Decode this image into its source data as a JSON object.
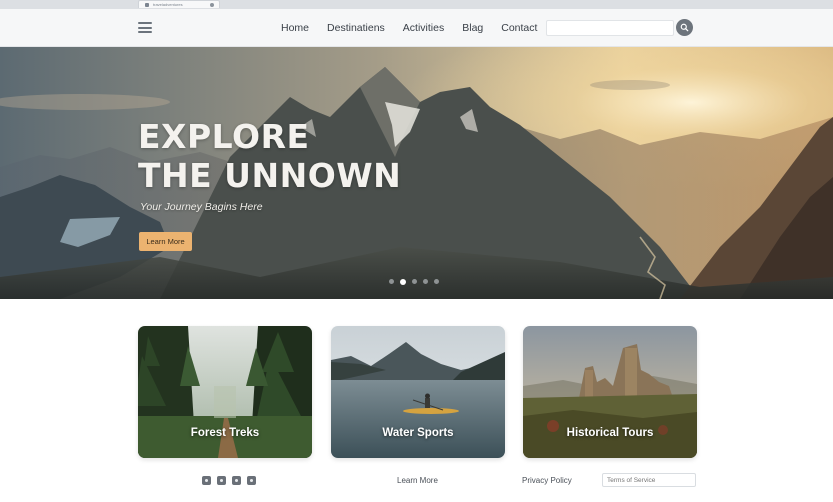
{
  "browser": {
    "tab_title": "traveladventures"
  },
  "navbar": {
    "links": [
      "Home",
      "Destinatiens",
      "Activities",
      "Blag",
      "Contact"
    ],
    "search_placeholder": ""
  },
  "hero": {
    "title_line1": "EXPLORE",
    "title_line2": "THE UNNOWN",
    "subtitle": "Your Journey Bagins Here",
    "button_label": "Learn More",
    "active_slide": 2,
    "slide_count": 5
  },
  "cards": [
    {
      "label": "Forest Treks"
    },
    {
      "label": "Water Sports"
    },
    {
      "label": "Historical Tours"
    }
  ],
  "footer": {
    "social_icons": [
      "social-icon-1",
      "social-icon-2",
      "social-icon-3",
      "social-icon-4"
    ],
    "learn_more": "Learn More",
    "privacy_policy": "Privacy Policy",
    "terms_placeholder": "Terms of Service"
  },
  "colors": {
    "accent_button": "#ecb370",
    "nav_background": "#f6f7f8"
  }
}
